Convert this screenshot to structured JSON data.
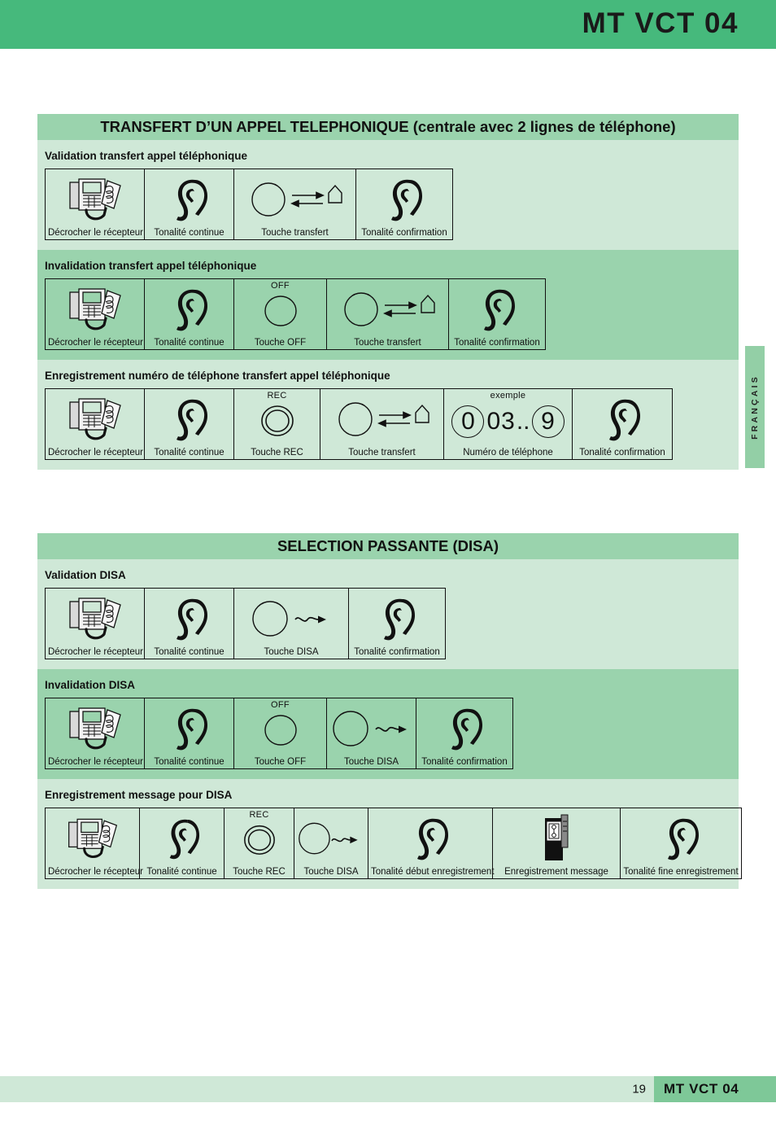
{
  "header": {
    "title": "MT VCT 04"
  },
  "side_tab": {
    "language": "FRANÇAIS"
  },
  "footer": {
    "page_number": "19",
    "brand": "MT VCT 04"
  },
  "captions": {
    "pickup": "Décrocher le récepteur",
    "continuous_tone": "Tonalité continue",
    "transfer_key": "Touche transfert",
    "confirm_tone": "Tonalité confirmation",
    "off_key": "Touche OFF",
    "rec_key": "Touche REC",
    "phone_number": "Numéro de téléphone",
    "disa_key": "Touche DISA",
    "rec_start_tone": "Tonalité début enregistrement",
    "record_message": "Enregistrement message",
    "rec_end_tone": "Tonalité fine enregistrement"
  },
  "top_labels": {
    "off": "OFF",
    "rec": "REC",
    "example": "exemple"
  },
  "example_number": {
    "d1": "0",
    "d2": "0",
    "d3": "3",
    "dots": "..",
    "d4": "9"
  },
  "sections": [
    {
      "title": "TRANSFERT D’UN APPEL TELEPHONIQUE (centrale avec 2 lignes de téléphone)",
      "subsections": [
        {
          "title": "Validation transfert appel téléphonique"
        },
        {
          "title": "Invalidation transfert appel téléphonique"
        },
        {
          "title": "Enregistrement numéro de téléphone transfert appel téléphonique"
        }
      ]
    },
    {
      "title": "SELECTION PASSANTE (DISA)",
      "subsections": [
        {
          "title": "Validation DISA"
        },
        {
          "title": "Invalidation DISA"
        },
        {
          "title": "Enregistrement message pour DISA"
        }
      ]
    }
  ],
  "colors": {
    "banner_green": "#46b97c",
    "mid_green": "#9ad3ad",
    "light_green": "#cfe8d7",
    "footer_brand_green": "#7ec898",
    "ink": "#111111"
  }
}
